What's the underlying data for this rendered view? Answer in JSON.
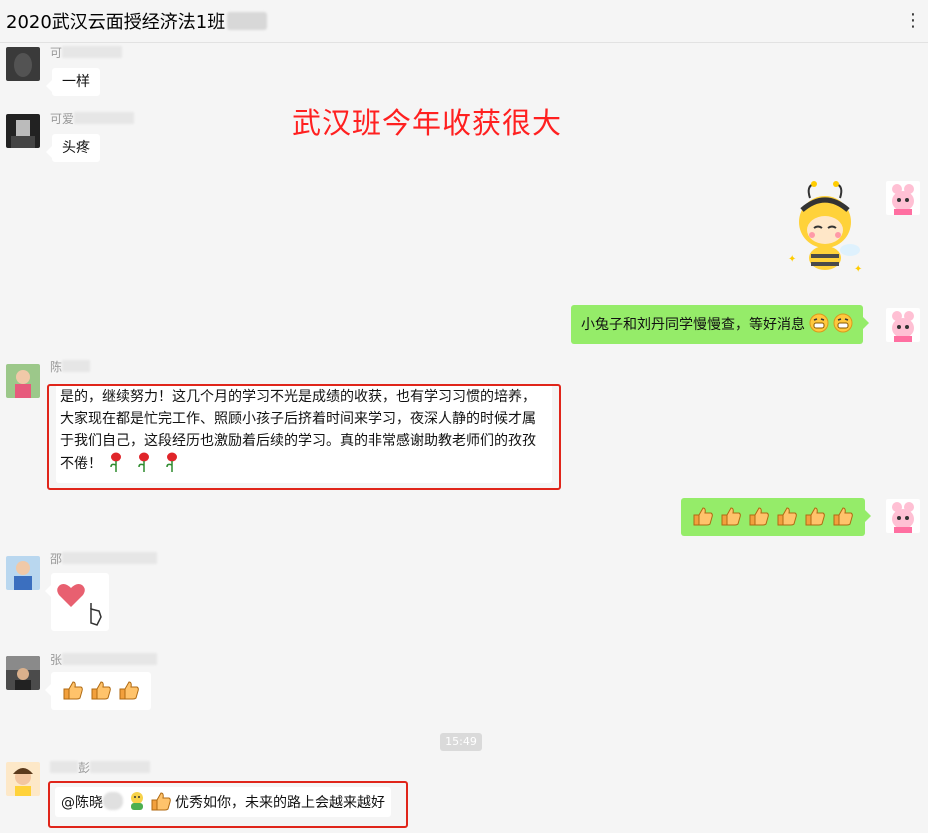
{
  "header": {
    "title": "2020武汉云面授经济法1班",
    "more_icon": "⋮"
  },
  "banner": "武汉班今年收获很大",
  "messages": {
    "m1": {
      "sender": "可",
      "text": "一样"
    },
    "m2": {
      "sender": "可爱",
      "text": "头疼"
    },
    "m4": {
      "text": "小兔子和刘丹同学慢慢查，等好消息"
    },
    "m5": {
      "sender": "陈",
      "text": "是的，继续努力！这几个月的学习不光是成绩的收获，也有学习习惯的培养，大家现在都是忙完工作、照顾小孩子后挤着时间来学习，夜深人静的时候才属于我们自己，这段经历也激励着后续的学习。真的非常感谢助教老师们的孜孜不倦！"
    },
    "m7": {
      "sender": "邵"
    },
    "m8": {
      "sender": "张"
    },
    "m9": {
      "sender": "彭",
      "mention": "@陈晓",
      "text": "优秀如你，未来的路上会越来越好"
    }
  },
  "time_divider": "15:49",
  "colors": {
    "accent_red": "#ff2020",
    "box_red": "#e0251a",
    "my_bubble": "#95ec69"
  }
}
